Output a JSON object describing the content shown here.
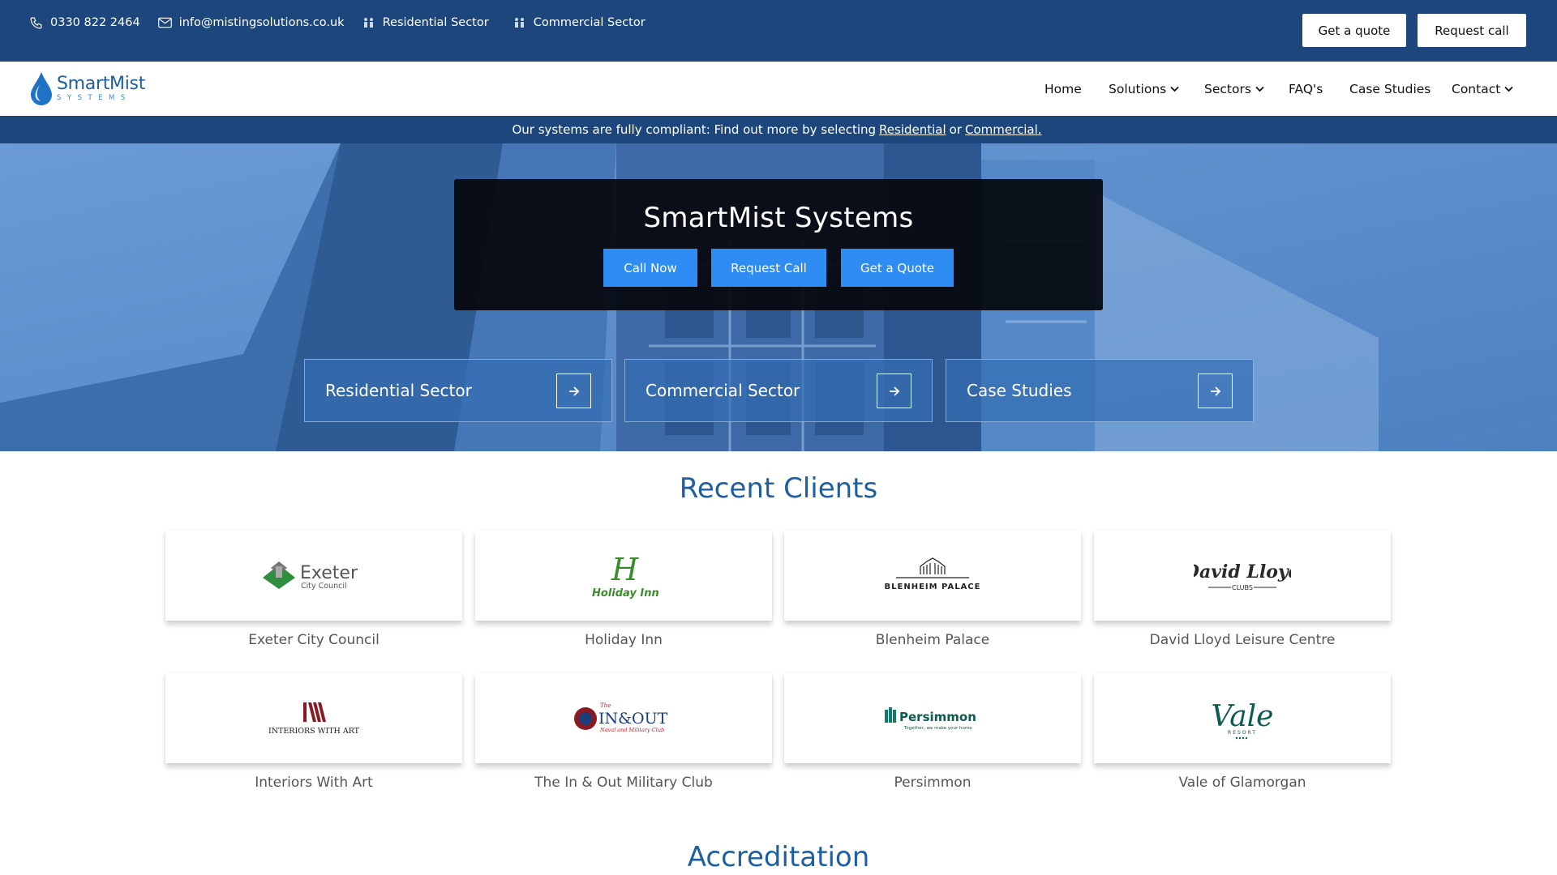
{
  "topbar": {
    "phone": "0330 822 2464",
    "email": "info@mistingsolutions.co.uk",
    "residential": "Residential Sector",
    "commercial": "Commercial Sector",
    "quote_button": "Get a quote",
    "call_button": "Request call"
  },
  "logo": {
    "name": "SmartMist",
    "sub": "SYSTEMS"
  },
  "nav": {
    "home": "Home",
    "solutions": "Solutions",
    "sectors": "Sectors",
    "faqs": "FAQ's",
    "case_studies": "Case Studies",
    "contact": "Contact"
  },
  "banner": {
    "text": "Our systems are fully compliant: Find out more by selecting",
    "residential_link": "Residential",
    "or": "or",
    "commercial_link": "Commercial."
  },
  "hero": {
    "title": "SmartMist Systems",
    "call_now": "Call Now",
    "request_call": "Request Call",
    "get_quote": "Get a Quote"
  },
  "sectors": [
    "Residential Sector",
    "Commercial Sector",
    "Case Studies"
  ],
  "clients": {
    "title": "Recent Clients",
    "items": [
      {
        "name": "Exeter City Council",
        "logo_text": "Exeter",
        "logo_sub": "City Council"
      },
      {
        "name": "Holiday Inn",
        "logo_text": "Holiday Inn",
        "logo_sub": "H"
      },
      {
        "name": "Blenheim Palace",
        "logo_text": "BLENHEIM PALACE"
      },
      {
        "name": "David Lloyd Leisure Centre",
        "logo_text": "David Lloyd",
        "logo_sub": "CLUBS"
      },
      {
        "name": "Interiors With Art",
        "logo_text": "INTERIORS WITH ART"
      },
      {
        "name": "The In & Out Military Club",
        "logo_text": "IN&OUT",
        "logo_pre": "The",
        "logo_sub": "Naval and Military Club"
      },
      {
        "name": "Persimmon",
        "logo_text": "Persimmon",
        "logo_sub": "Together, we make your home"
      },
      {
        "name": "Vale of Glamorgan",
        "logo_text": "Vale",
        "logo_sub": "RESORT"
      }
    ]
  },
  "accreditation": {
    "title": "Accreditation"
  },
  "colors": {
    "primary": "#1d477c",
    "accent": "#2e8cf2",
    "heading": "#1d5fa0"
  }
}
